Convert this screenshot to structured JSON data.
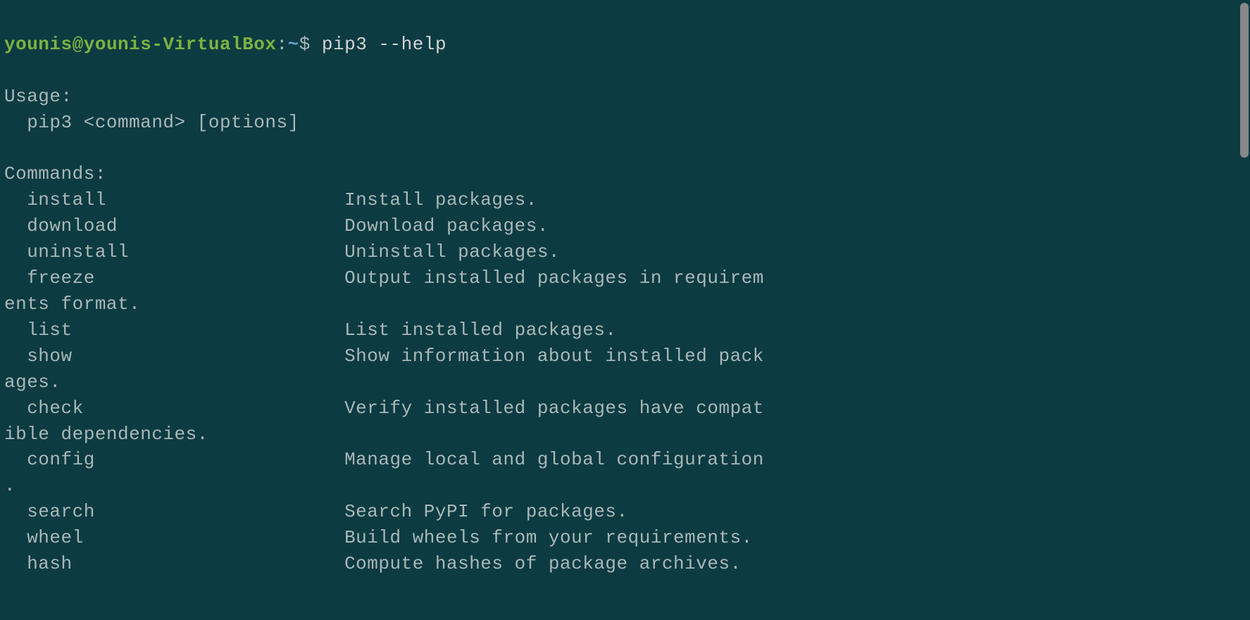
{
  "prompt": {
    "user": "younis",
    "at": "@",
    "host": "younis-VirtualBox",
    "colon": ":",
    "path": "~",
    "dollar": "$"
  },
  "command": " pip3 --help",
  "output": {
    "blank1": "",
    "usage_header": "Usage:",
    "usage_line": "  pip3 <command> [options]",
    "blank2": "",
    "commands_header": "Commands:",
    "lines": [
      "  install                     Install packages.",
      "  download                    Download packages.",
      "  uninstall                   Uninstall packages.",
      "  freeze                      Output installed packages in requirem",
      "ents format.",
      "  list                        List installed packages.",
      "  show                        Show information about installed pack",
      "ages.",
      "  check                       Verify installed packages have compat",
      "ible dependencies.",
      "  config                      Manage local and global configuration",
      ".",
      "  search                      Search PyPI for packages.",
      "  wheel                       Build wheels from your requirements.",
      "  hash                        Compute hashes of package archives."
    ]
  }
}
